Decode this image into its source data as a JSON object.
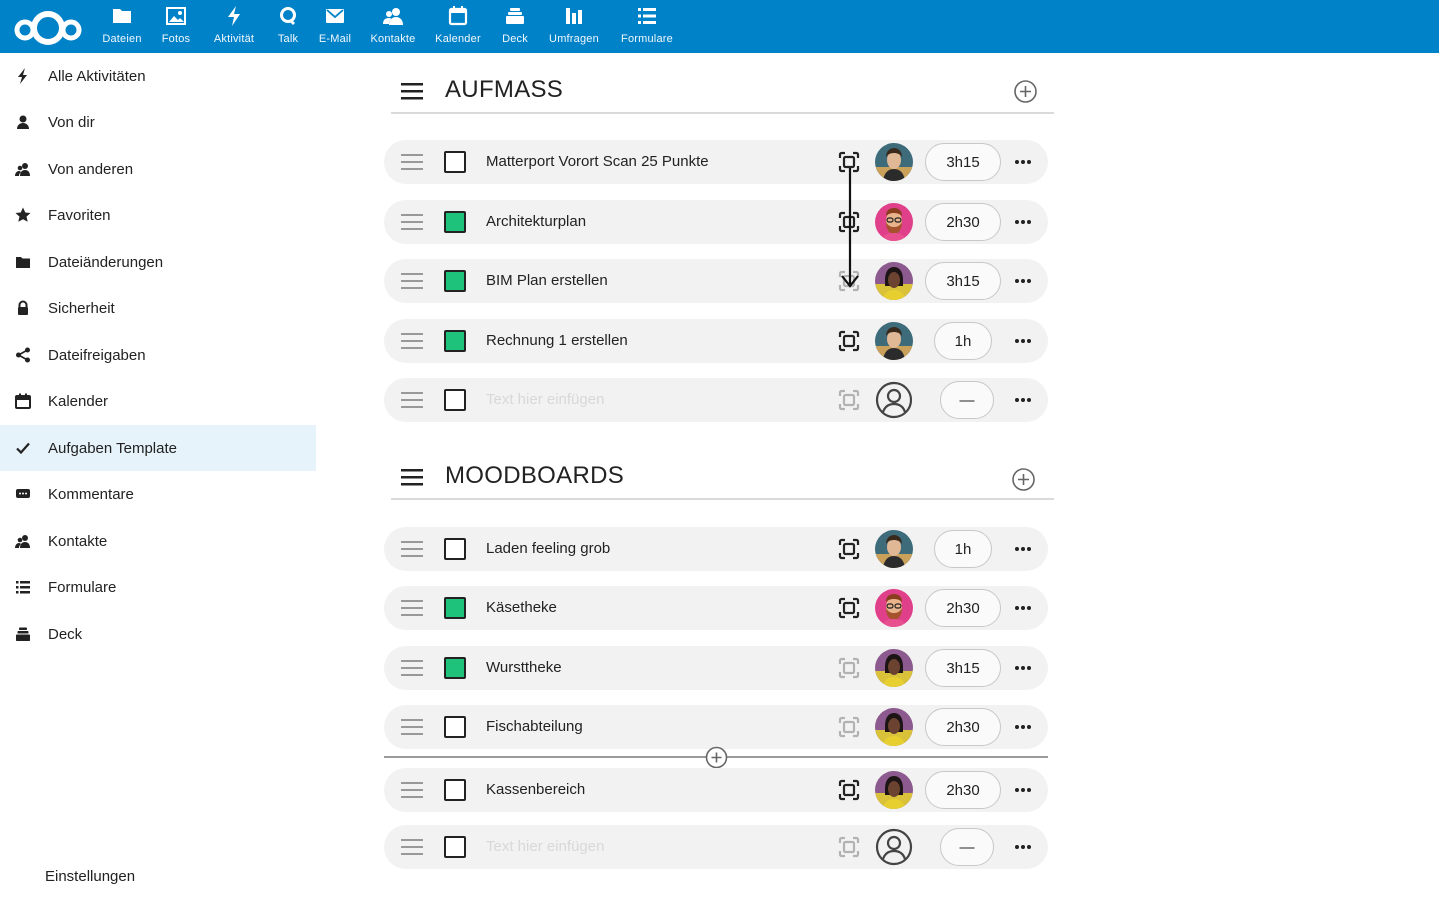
{
  "topbar": {
    "background": "#0082c9",
    "logo_icon": "nextcloud-logo",
    "apps": [
      {
        "label": "Dateien",
        "icon": "folder-icon"
      },
      {
        "label": "Fotos",
        "icon": "image-icon"
      },
      {
        "label": "Aktivität",
        "icon": "lightning-icon"
      },
      {
        "label": "Talk",
        "icon": "talk-icon"
      },
      {
        "label": "E-Mail",
        "icon": "mail-icon"
      },
      {
        "label": "Kontakte",
        "icon": "contacts-icon"
      },
      {
        "label": "Kalender",
        "icon": "calendar-icon"
      },
      {
        "label": "Deck",
        "icon": "deck-icon"
      },
      {
        "label": "Umfragen",
        "icon": "poll-icon"
      },
      {
        "label": "Formulare",
        "icon": "forms-icon"
      }
    ]
  },
  "sidebar": {
    "active_color": "#e6f3fa",
    "items": [
      {
        "label": "Alle Aktivitäten",
        "icon": "lightning-icon"
      },
      {
        "label": "Von dir",
        "icon": "user-icon"
      },
      {
        "label": "Von anderen",
        "icon": "users-icon"
      },
      {
        "label": "Favoriten",
        "icon": "star-icon"
      },
      {
        "label": "Dateiänderungen",
        "icon": "folder-icon"
      },
      {
        "label": "Sicherheit",
        "icon": "lock-icon"
      },
      {
        "label": "Dateifreigaben",
        "icon": "share-icon"
      },
      {
        "label": "Kalender",
        "icon": "calendar-icon"
      },
      {
        "label": "Aufgaben Template",
        "icon": "check-icon",
        "active": true
      },
      {
        "label": "Kommentare",
        "icon": "comment-icon"
      },
      {
        "label": "Kontakte",
        "icon": "contacts-icon"
      },
      {
        "label": "Formulare",
        "icon": "forms-icon"
      },
      {
        "label": "Deck",
        "icon": "deck-icon"
      }
    ],
    "settings_label": "Einstellungen"
  },
  "sections": [
    {
      "title": "AUFMASS",
      "tasks": [
        {
          "text": "Matterport Vorort Scan 25 Punkte",
          "done": false,
          "scan_active": true,
          "avatar": "avatar-man-teal",
          "time": "3h15"
        },
        {
          "text": "Architekturplan",
          "done": true,
          "scan_active": true,
          "avatar": "avatar-man-pink",
          "time": "2h30"
        },
        {
          "text": "BIM Plan erstellen",
          "done": true,
          "scan_active": false,
          "avatar": "avatar-woman-yellow",
          "time": "3h15"
        },
        {
          "text": "Rechnung 1 erstellen",
          "done": true,
          "scan_active": true,
          "avatar": "avatar-man-teal",
          "time": "1h"
        }
      ],
      "new_task": {
        "placeholder": "Text hier einfügen",
        "time": "—"
      }
    },
    {
      "title": "MOODBOARDS",
      "tasks": [
        {
          "text": "Laden feeling grob",
          "done": false,
          "scan_active": true,
          "avatar": "avatar-man-teal",
          "time": "1h"
        },
        {
          "text": "Käsetheke",
          "done": true,
          "scan_active": true,
          "avatar": "avatar-man-pink",
          "time": "2h30"
        },
        {
          "text": "Wursttheke",
          "done": true,
          "scan_active": false,
          "avatar": "avatar-woman-yellow",
          "time": "3h15"
        },
        {
          "text": "Fischabteilung",
          "done": false,
          "scan_active": false,
          "avatar": "avatar-woman-yellow",
          "time": "2h30"
        },
        {
          "text": "Kassenbereich",
          "done": false,
          "scan_active": true,
          "avatar": "avatar-woman-yellow",
          "time": "2h30"
        }
      ],
      "new_task": {
        "placeholder": "Text hier einfügen",
        "time": "—"
      }
    }
  ],
  "colors": {
    "done_checkbox": "#1fc27a",
    "row_background": "#f2f2f2"
  }
}
